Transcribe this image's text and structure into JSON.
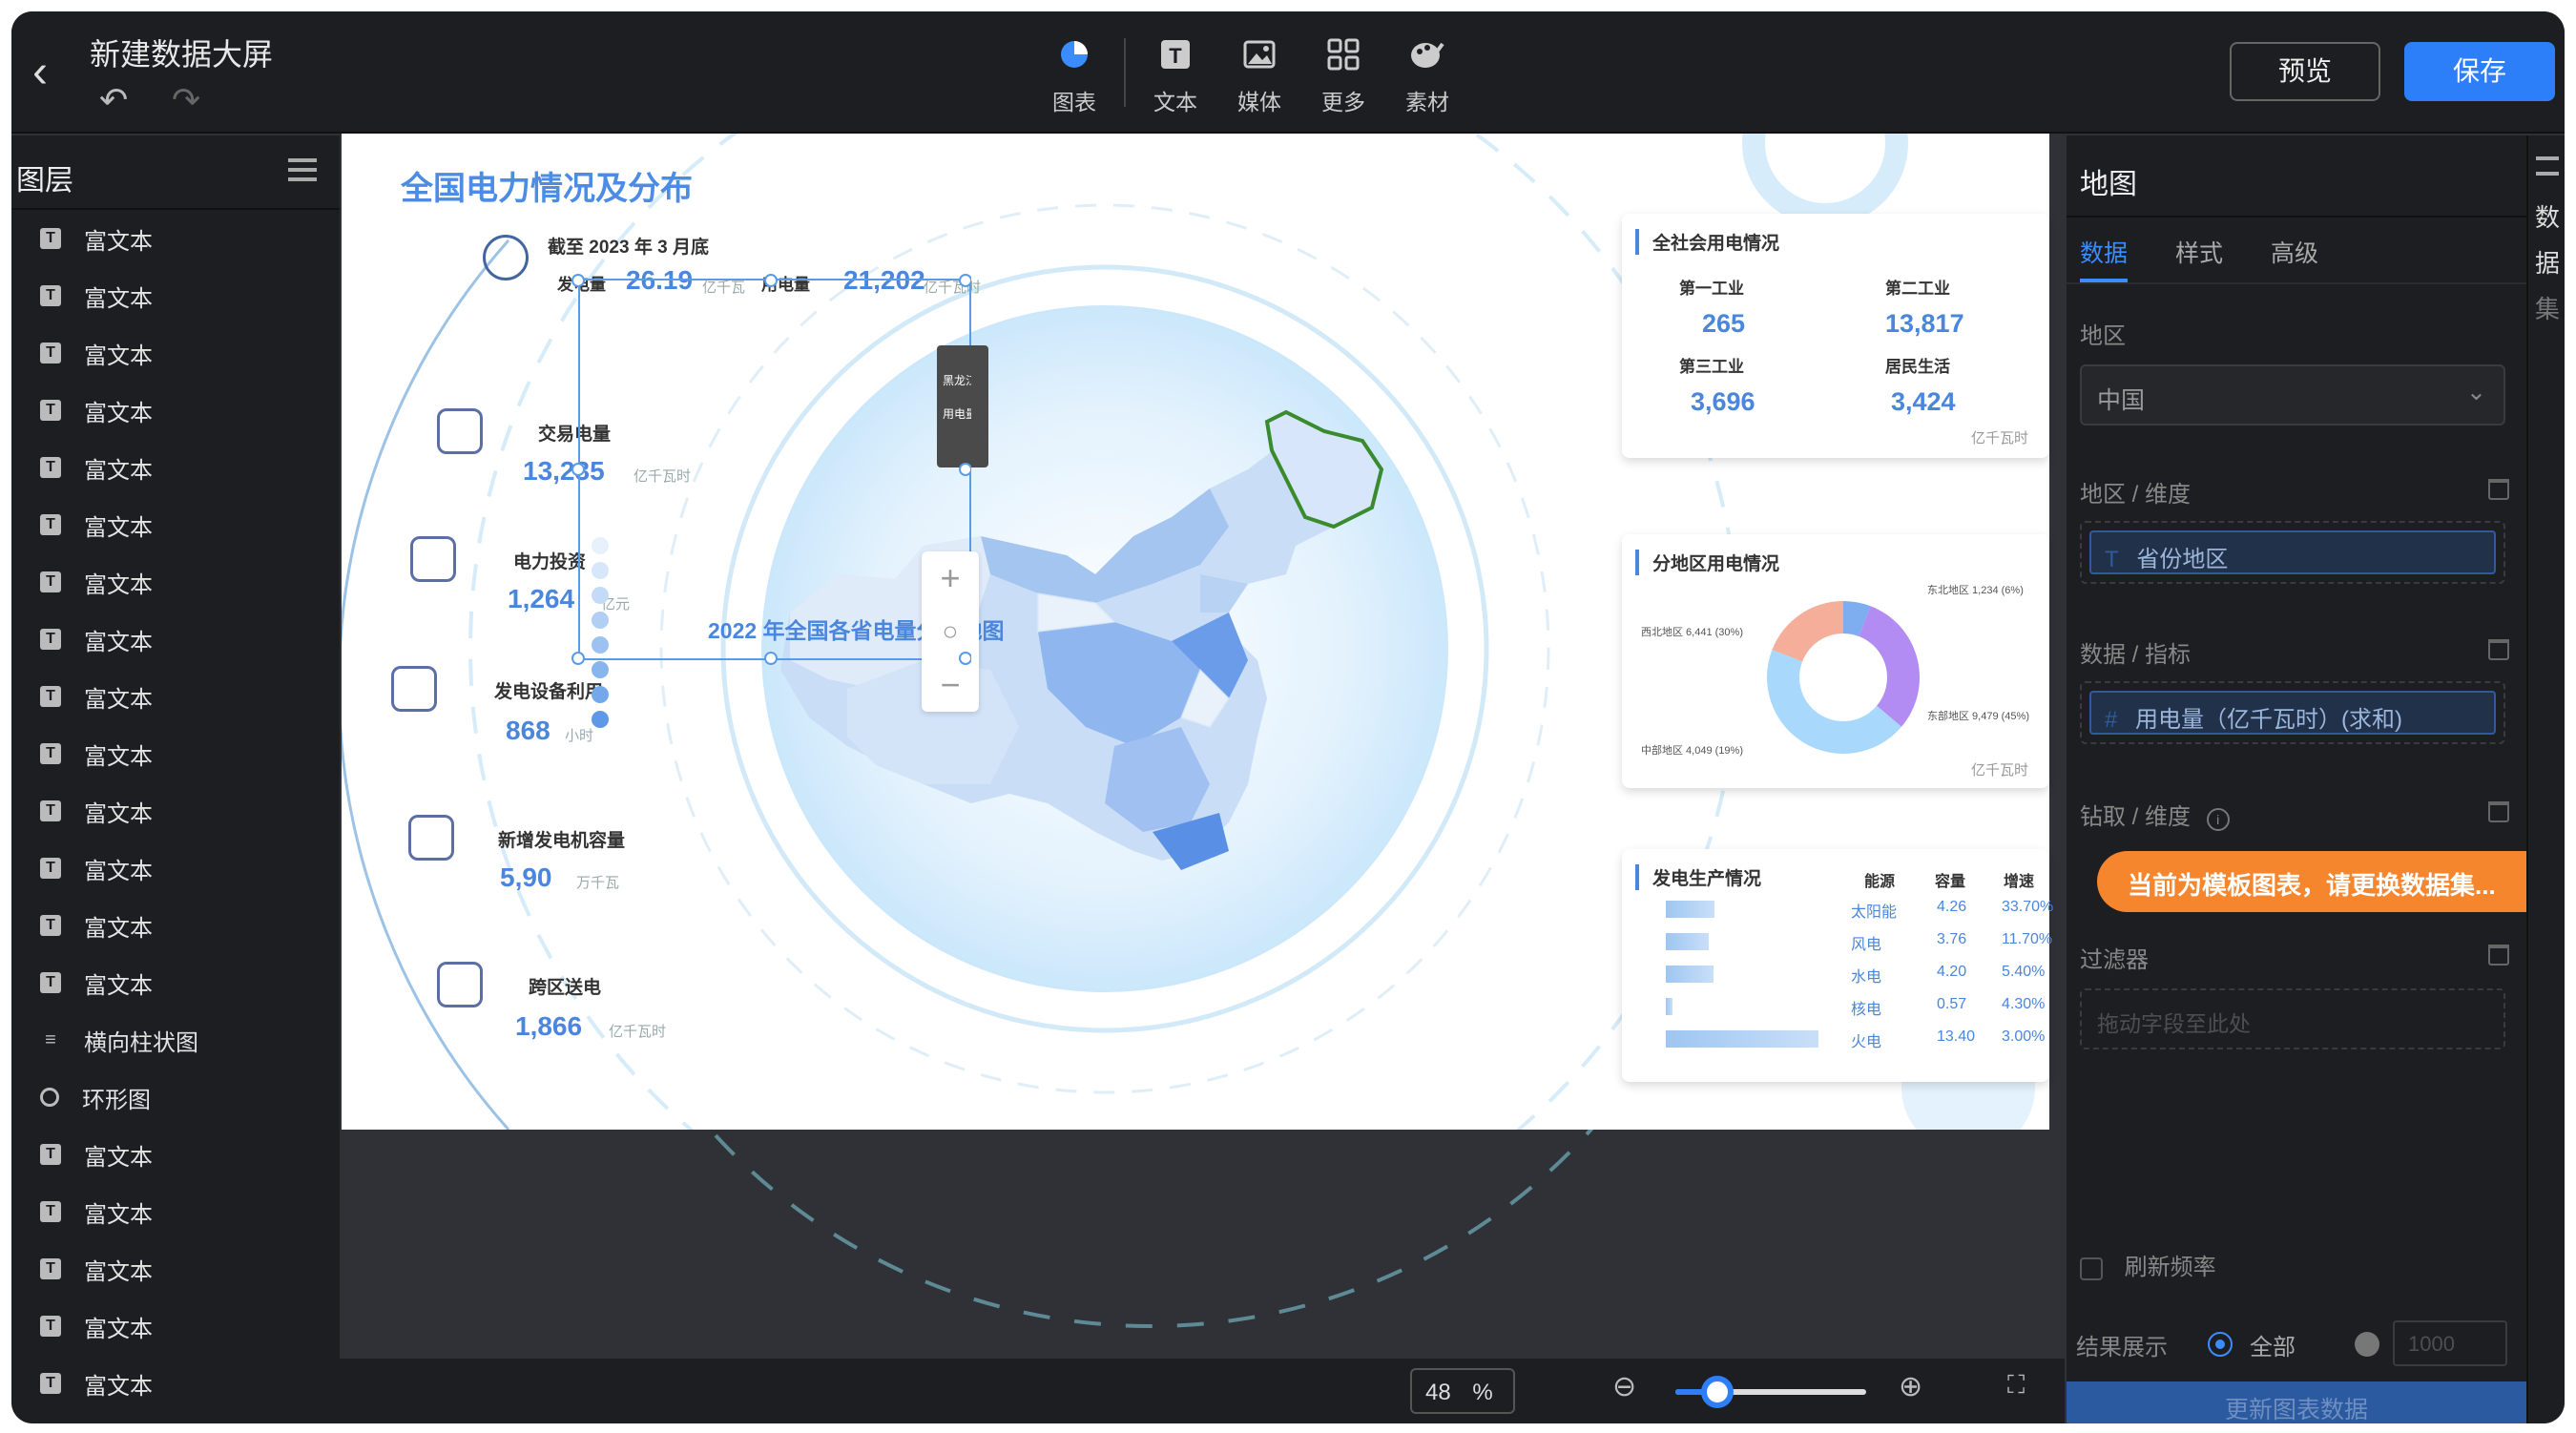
{
  "topbar": {
    "title": "新建数据大屏",
    "tools": [
      {
        "label": "图表",
        "icon": "chart-icon"
      },
      {
        "label": "文本",
        "icon": "text-icon"
      },
      {
        "label": "媒体",
        "icon": "media-icon"
      },
      {
        "label": "更多",
        "icon": "more-icon"
      },
      {
        "label": "素材",
        "icon": "material-icon"
      }
    ],
    "preview_label": "预览",
    "save_label": "保存"
  },
  "layers": {
    "title": "图层",
    "items": [
      {
        "label": "富文本",
        "type": "text"
      },
      {
        "label": "富文本",
        "type": "text"
      },
      {
        "label": "富文本",
        "type": "text"
      },
      {
        "label": "富文本",
        "type": "text"
      },
      {
        "label": "富文本",
        "type": "text"
      },
      {
        "label": "富文本",
        "type": "text"
      },
      {
        "label": "富文本",
        "type": "text"
      },
      {
        "label": "富文本",
        "type": "text"
      },
      {
        "label": "富文本",
        "type": "text"
      },
      {
        "label": "富文本",
        "type": "text"
      },
      {
        "label": "富文本",
        "type": "text"
      },
      {
        "label": "富文本",
        "type": "text"
      },
      {
        "label": "富文本",
        "type": "text"
      },
      {
        "label": "富文本",
        "type": "text"
      },
      {
        "label": "横向柱状图",
        "type": "bar"
      },
      {
        "label": "环形图",
        "type": "ring"
      },
      {
        "label": "富文本",
        "type": "text"
      },
      {
        "label": "富文本",
        "type": "text"
      },
      {
        "label": "富文本",
        "type": "text"
      },
      {
        "label": "富文本",
        "type": "text"
      },
      {
        "label": "富文本",
        "type": "text"
      }
    ]
  },
  "screen": {
    "title": "全国电力情况及分布",
    "asof": "截至 2023 年 3 月底",
    "gen_label": "发电量",
    "gen_value": "26.19",
    "gen_unit": "亿千瓦",
    "use_label": "用电量",
    "use_value": "21,202",
    "use_unit": "亿千瓦时",
    "stats": [
      {
        "label": "交易电量",
        "value": "13,235",
        "unit": "亿千瓦时"
      },
      {
        "label": "电力投资",
        "value": "1,264",
        "unit": "亿元"
      },
      {
        "label": "发电设备利用",
        "value": "868",
        "unit": "小时"
      },
      {
        "label": "新增发电机容量",
        "value": "5,90",
        "unit": "万千瓦"
      },
      {
        "label": "跨区送电",
        "value": "1,866",
        "unit": "亿千瓦时"
      }
    ],
    "map_title": "2022 年全国各省电量分布地图",
    "tooltip_region": "黑龙江",
    "tooltip_metric": "用电量",
    "society": {
      "title": "全社会用电情况",
      "cells": [
        {
          "label": "第一工业",
          "value": "265"
        },
        {
          "label": "第二工业",
          "value": "13,817"
        },
        {
          "label": "第三工业",
          "value": "3,696"
        },
        {
          "label": "居民生活",
          "value": "3,424"
        }
      ],
      "unit": "亿千瓦时"
    },
    "region": {
      "title": "分地区用电情况",
      "unit": "亿千瓦时",
      "labels": [
        "东北地区 1,234 (6%)",
        "西北地区 6,441 (30%)",
        "东部地区 9,479 (45%)",
        "中部地区 4,049 (19%)"
      ]
    },
    "production": {
      "title": "发电生产情况",
      "headers": [
        "能源",
        "容量",
        "增速"
      ],
      "rows": [
        {
          "name": "太阳能",
          "cap": "4.26",
          "growth": "33.70%"
        },
        {
          "name": "风电",
          "cap": "3.76",
          "growth": "11.70%"
        },
        {
          "name": "水电",
          "cap": "4.20",
          "growth": "5.40%"
        },
        {
          "name": "核电",
          "cap": "0.57",
          "growth": "4.30%"
        },
        {
          "name": "火电",
          "cap": "13.40",
          "growth": "3.00%"
        }
      ]
    }
  },
  "chart_data": {
    "type": "pie",
    "title": "分地区用电情况",
    "categories": [
      "东北地区",
      "西北地区",
      "东部地区",
      "中部地区"
    ],
    "values": [
      1234,
      6441,
      9479,
      4049
    ],
    "colors": [
      "#7eaef0",
      "#b28cf2",
      "#a8d8fb",
      "#f4ae9a"
    ]
  },
  "zoom": {
    "value": "48",
    "unit": "%",
    "level": 0.22
  },
  "panel": {
    "title": "地图",
    "tabs": [
      "数据",
      "样式",
      "高级"
    ],
    "region_label": "地区",
    "region_value": "中国",
    "dim_label": "地区 / 维度",
    "dim_chip": "省份地区",
    "metric_label": "数据 / 指标",
    "metric_chip": "用电量（亿千瓦时）(求和)",
    "drill_label": "钻取 / 维度",
    "warning": "当前为模板图表，请更换数据集...",
    "filter_label": "过滤器",
    "filter_placeholder": "拖动字段至此处",
    "refresh_label": "刷新频率",
    "result_label": "结果展示",
    "result_all": "全部",
    "result_count": "1000",
    "update_label": "更新图表数据"
  },
  "strip_label": [
    "数",
    "据",
    "集"
  ]
}
